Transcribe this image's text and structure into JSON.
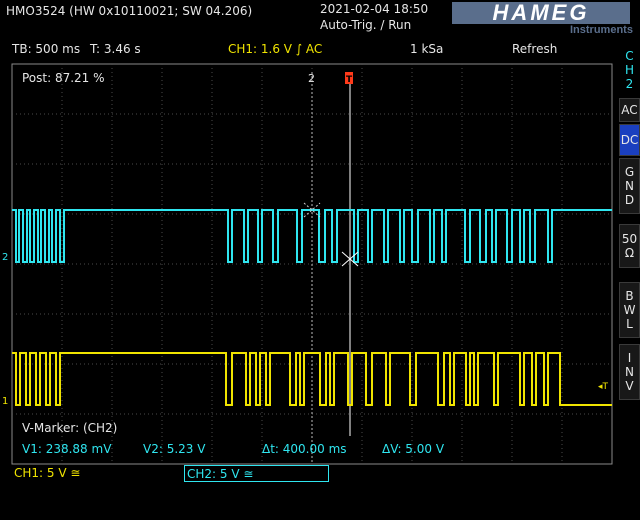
{
  "header": {
    "model": "HMO3524 (HW 0x10110021; SW 04.206)",
    "datetime": "2021-02-04 18:50",
    "trigger_status": "Auto-Trig. / Run",
    "brand": "HAMEG",
    "brand_sub": "Instruments"
  },
  "topbar": {
    "timebase": "TB: 500 ms",
    "trigger_time": "T: 3.46 s",
    "ch1_trigger": "CH1: 1.6 V ∫ AC",
    "sample_rate": "1 kSa",
    "mode": "Refresh"
  },
  "side_menu": {
    "channel_label": [
      "C",
      "H",
      "2"
    ],
    "ac": "AC",
    "dc": "DC",
    "gnd": [
      "G",
      "N",
      "D"
    ],
    "ohm": [
      "50",
      "Ω"
    ],
    "bwl": [
      "B",
      "W",
      "L"
    ],
    "inv": [
      "I",
      "N",
      "V"
    ]
  },
  "plot": {
    "post_label": "Post: 87.21 %",
    "marker2": "2",
    "marker_trig": "T",
    "ch2_ref": "2",
    "ch1_ref": "1",
    "trig_level_right": "◂T"
  },
  "marker_panel": {
    "title": "V-Marker: (CH2)",
    "v1": "V1: 238.88 mV",
    "v2": "V2: 5.23 V",
    "dt": "Δt: 400.00 ms",
    "dv": "ΔV: 5.00 V"
  },
  "channels": {
    "ch1": "CH1: 5 V ≅",
    "ch2": "CH2: 5 V ≅"
  },
  "colors": {
    "ch1": "#f0e400",
    "ch2": "#2fe6f0",
    "grid": "#4a4a4a",
    "active_button": "#1a3fbf"
  }
}
